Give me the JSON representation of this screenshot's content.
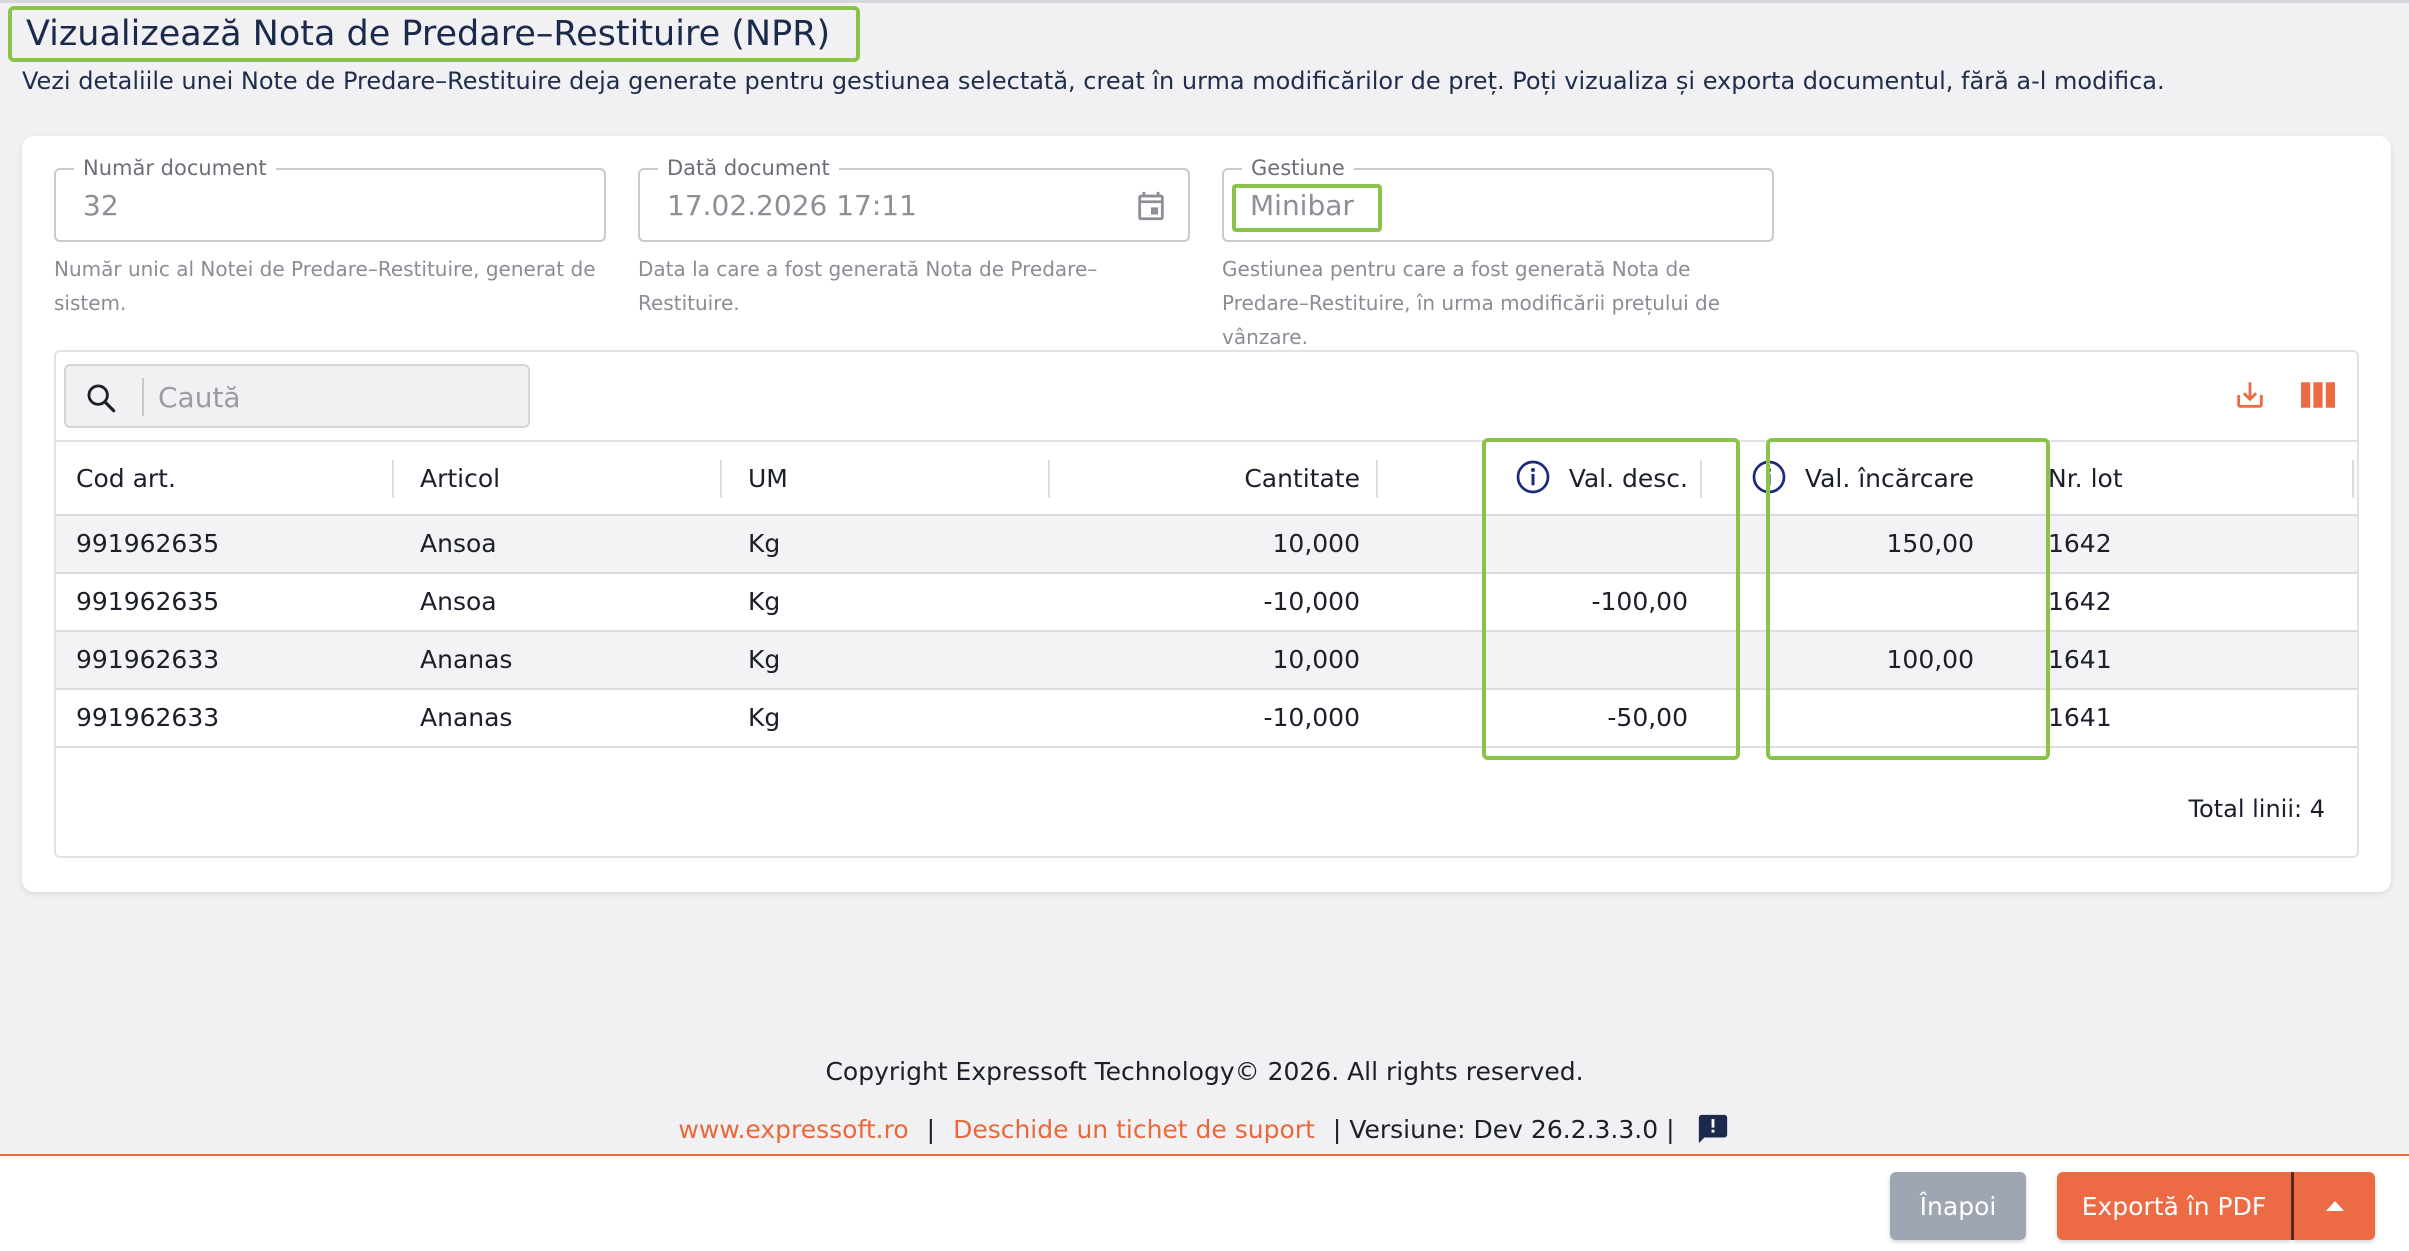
{
  "header": {
    "title": "Vizualizează Nota de Predare–Restituire (NPR)",
    "subtitle": "Vezi detaliile unei Note de Predare–Restituire deja generate pentru gestiunea selectată, creat în urma modificărilor de preț. Poți vizualiza și exporta documentul, fără a-l modifica."
  },
  "fields": {
    "numar_document": {
      "label": "Număr document",
      "value": "32",
      "helper": "Număr unic al Notei de Predare–Restituire, generat de sistem."
    },
    "data_document": {
      "label": "Dată document",
      "value": "17.02.2026 17:11",
      "helper": "Data la care a fost generată Nota de Predare–Restituire.",
      "icon": "calendar-icon"
    },
    "gestiune": {
      "label": "Gestiune",
      "value": "Minibar",
      "helper": "Gestiunea pentru care a fost generată Nota de Predare–Restituire, în urma modificării prețului de vânzare."
    }
  },
  "table": {
    "search_placeholder": "Caută",
    "columns": {
      "cod_art": "Cod art.",
      "articol": "Articol",
      "um": "UM",
      "cantitate": "Cantitate",
      "val_desc": "Val. desc.",
      "val_incarcare": "Val. încărcare",
      "nr_lot": "Nr. lot"
    },
    "rows": [
      {
        "cod_art": "991962635",
        "articol": "Ansoa",
        "um": "Kg",
        "cantitate": "10,000",
        "val_desc": "",
        "val_incarcare": "150,00",
        "nr_lot": "1642"
      },
      {
        "cod_art": "991962635",
        "articol": "Ansoa",
        "um": "Kg",
        "cantitate": "-10,000",
        "val_desc": "-100,00",
        "val_incarcare": "",
        "nr_lot": "1642"
      },
      {
        "cod_art": "991962633",
        "articol": "Ananas",
        "um": "Kg",
        "cantitate": "10,000",
        "val_desc": "",
        "val_incarcare": "100,00",
        "nr_lot": "1641"
      },
      {
        "cod_art": "991962633",
        "articol": "Ananas",
        "um": "Kg",
        "cantitate": "-10,000",
        "val_desc": "-50,00",
        "val_incarcare": "",
        "nr_lot": "1641"
      }
    ],
    "total": "Total linii: 4"
  },
  "footer": {
    "copyright": "Copyright Expressoft Technology© 2026. All rights reserved.",
    "website": "www.expressoft.ro",
    "support": "Deschide un tichet de suport",
    "version": "Versiune: Dev 26.2.3.3.0",
    "separator": "|"
  },
  "actions": {
    "back": "Înapoi",
    "export": "Exportă în PDF"
  },
  "colors": {
    "accent": "#ec6b45",
    "highlight": "#8bc34a",
    "back_button": "#9ea6b3",
    "navy": "#1b2a4a"
  }
}
